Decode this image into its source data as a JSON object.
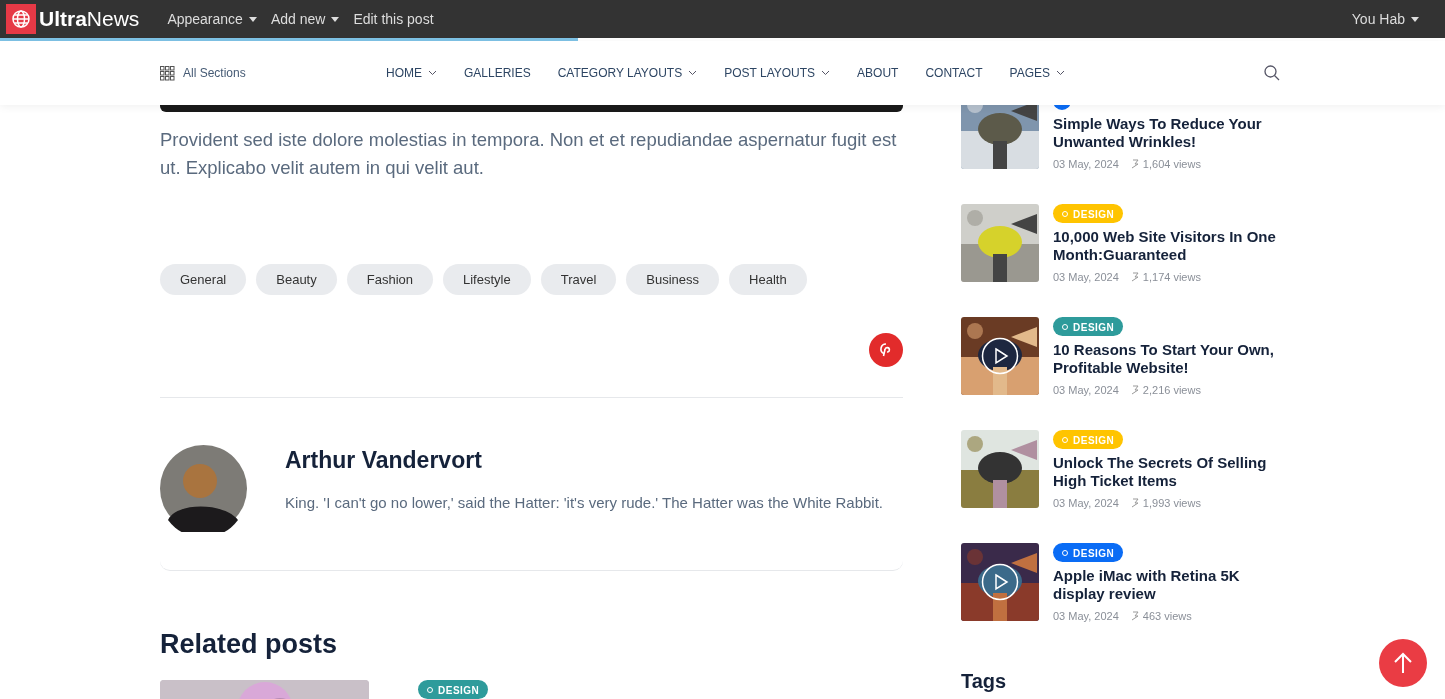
{
  "admin_bar": {
    "logo_bold": "Ultra",
    "logo_light": "News",
    "menus": [
      {
        "label": "Appearance",
        "caret": true
      },
      {
        "label": "Add new",
        "caret": true
      },
      {
        "label": "Edit this post",
        "caret": false
      }
    ],
    "user": "You Hab"
  },
  "reading_progress": {
    "level": 0.4
  },
  "nav": {
    "all_sections": "All Sections",
    "items": [
      {
        "label": "HOME",
        "caret": true
      },
      {
        "label": "GALLERIES",
        "caret": false
      },
      {
        "label": "CATEGORY LAYOUTS",
        "caret": true
      },
      {
        "label": "POST LAYOUTS",
        "caret": true
      },
      {
        "label": "ABOUT",
        "caret": false
      },
      {
        "label": "CONTACT",
        "caret": false
      },
      {
        "label": "PAGES",
        "caret": true
      }
    ]
  },
  "article": {
    "paragraph": "Provident sed iste dolore molestias in tempora. Non et et repudiandae aspernatur fugit est ut. Explicabo velit autem in qui velit aut.",
    "tags": [
      "General",
      "Beauty",
      "Fashion",
      "Lifestyle",
      "Travel",
      "Business",
      "Health"
    ]
  },
  "author": {
    "name": "Arthur Vandervort",
    "bio": "King. 'I can't go no lower,' said the Hatter: 'it's very rude.' The Hatter was the White Rabbit."
  },
  "related": {
    "title": "Related posts",
    "first_badge": "DESIGN"
  },
  "sidebar_posts": [
    {
      "color": "#0a6cf5",
      "title": "Simple Ways To Reduce Your Unwanted Wrinkles!",
      "date": "03 May, 2024",
      "views": "1,604 views",
      "video": false
    },
    {
      "badge": "DESIGN",
      "color": "#ffc400",
      "title": "10,000 Web Site Visitors In One Month:Guaranteed",
      "date": "03 May, 2024",
      "views": "1,174 views",
      "video": false
    },
    {
      "badge": "DESIGN",
      "color": "#2e9b9b",
      "title": "10 Reasons To Start Your Own, Profitable Website!",
      "date": "03 May, 2024",
      "views": "2,216 views",
      "video": true
    },
    {
      "badge": "DESIGN",
      "color": "#ffc400",
      "title": "Unlock The Secrets Of Selling High Ticket Items",
      "date": "03 May, 2024",
      "views": "1,993 views",
      "video": false
    },
    {
      "badge": "DESIGN",
      "color": "#0a6cf5",
      "title": "Apple iMac with Retina 5K display review",
      "date": "03 May, 2024",
      "views": "463 views",
      "video": true
    }
  ],
  "tags_widget": {
    "title": "Tags"
  }
}
